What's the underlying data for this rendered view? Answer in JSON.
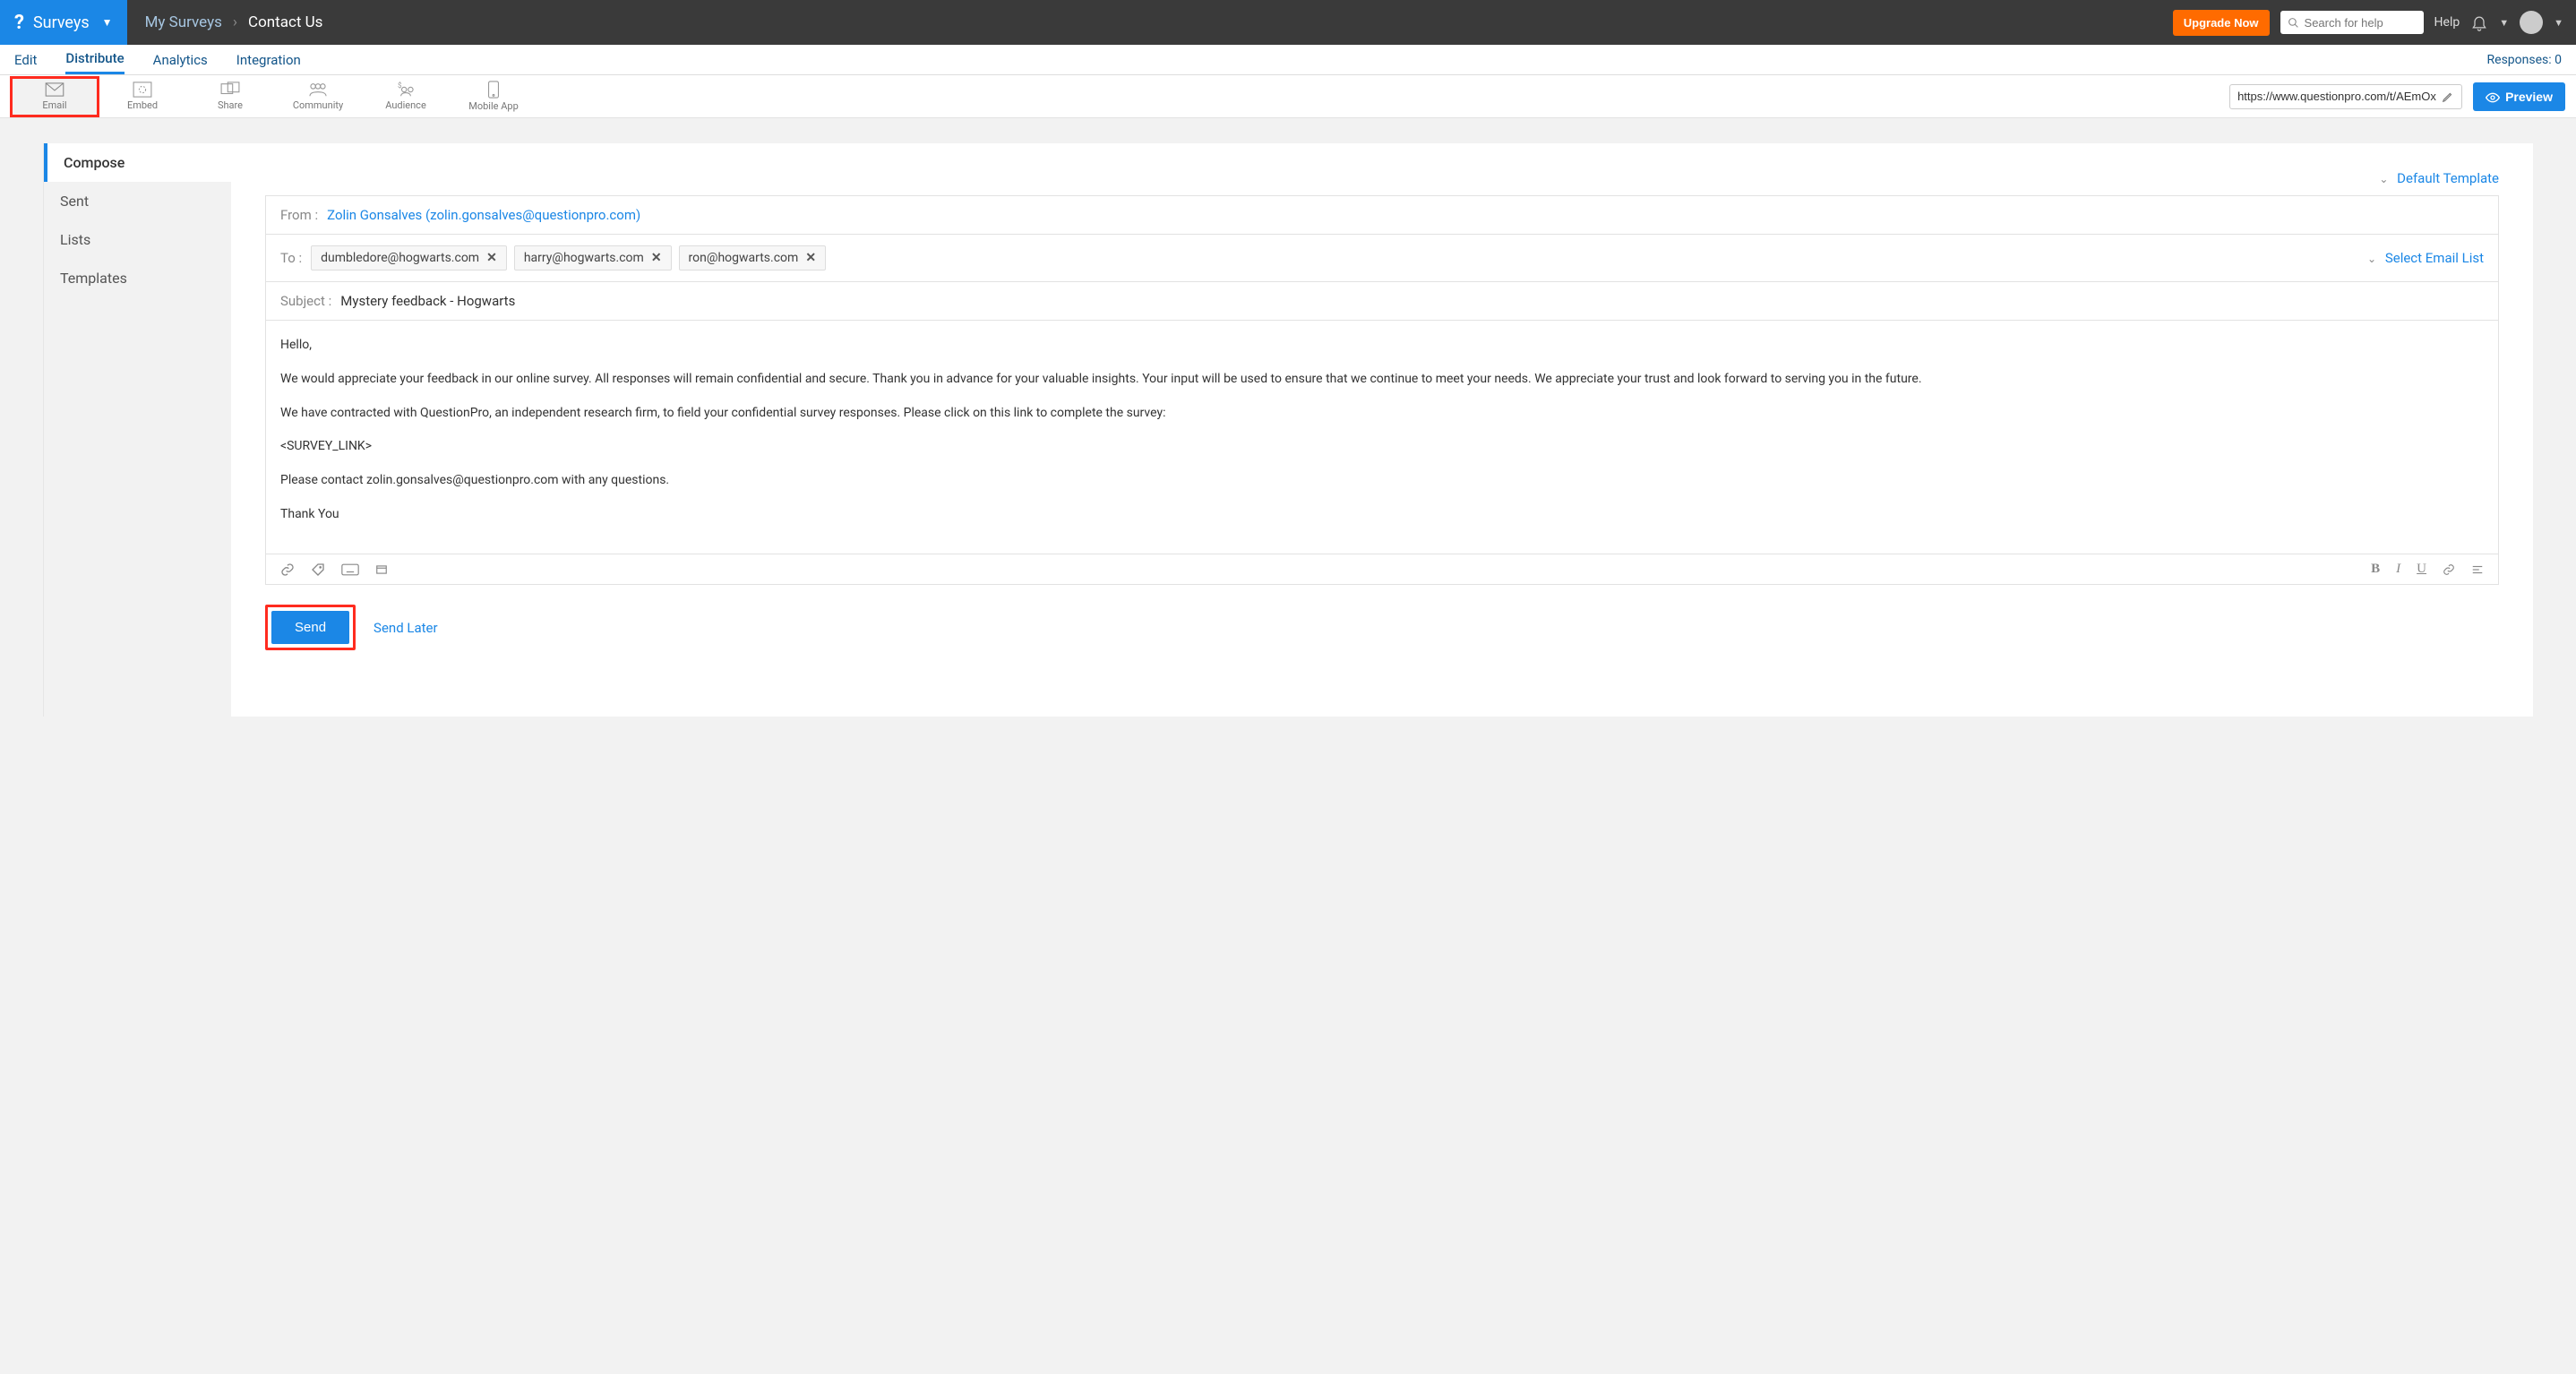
{
  "brand": {
    "name": "Surveys"
  },
  "breadcrumb": {
    "link": "My Surveys",
    "current": "Contact Us"
  },
  "topbar": {
    "upgrade": "Upgrade Now",
    "search_placeholder": "Search for help",
    "help": "Help"
  },
  "tabs": {
    "edit": "Edit",
    "distribute": "Distribute",
    "analytics": "Analytics",
    "integration": "Integration",
    "responses": "Responses: 0"
  },
  "dist_icons": {
    "email": "Email",
    "embed": "Embed",
    "share": "Share",
    "community": "Community",
    "audience": "Audience",
    "mobile": "Mobile App"
  },
  "survey_url": "https://www.questionpro.com/t/AEmOx",
  "preview_label": "Preview",
  "sidenav": {
    "compose": "Compose",
    "sent": "Sent",
    "lists": "Lists",
    "templates": "Templates"
  },
  "template_link": "Default Template",
  "compose": {
    "from_label": "From :",
    "from_value": "Zolin Gonsalves (zolin.gonsalves@questionpro.com)",
    "to_label": "To :",
    "recipients": [
      "dumbledore@hogwarts.com",
      "harry@hogwarts.com",
      "ron@hogwarts.com"
    ],
    "select_list": "Select Email List",
    "subject_label": "Subject :",
    "subject_value": "Mystery feedback - Hogwarts",
    "body": {
      "p1": "Hello,",
      "p2": "We would appreciate your feedback in our online survey.  All responses will remain confidential and secure.  Thank you in advance for your valuable insights.  Your input will be used to ensure that we continue to meet your needs. We appreciate your trust and look forward to serving you in the future.",
      "p3": "We have contracted with QuestionPro, an independent research firm, to field your confidential survey responses.  Please click on this link to complete the survey:",
      "p4": "<SURVEY_LINK>",
      "p5": "Please contact zolin.gonsalves@questionpro.com with any questions.",
      "p6": "Thank You"
    }
  },
  "buttons": {
    "send": "Send",
    "send_later": "Send Later"
  }
}
